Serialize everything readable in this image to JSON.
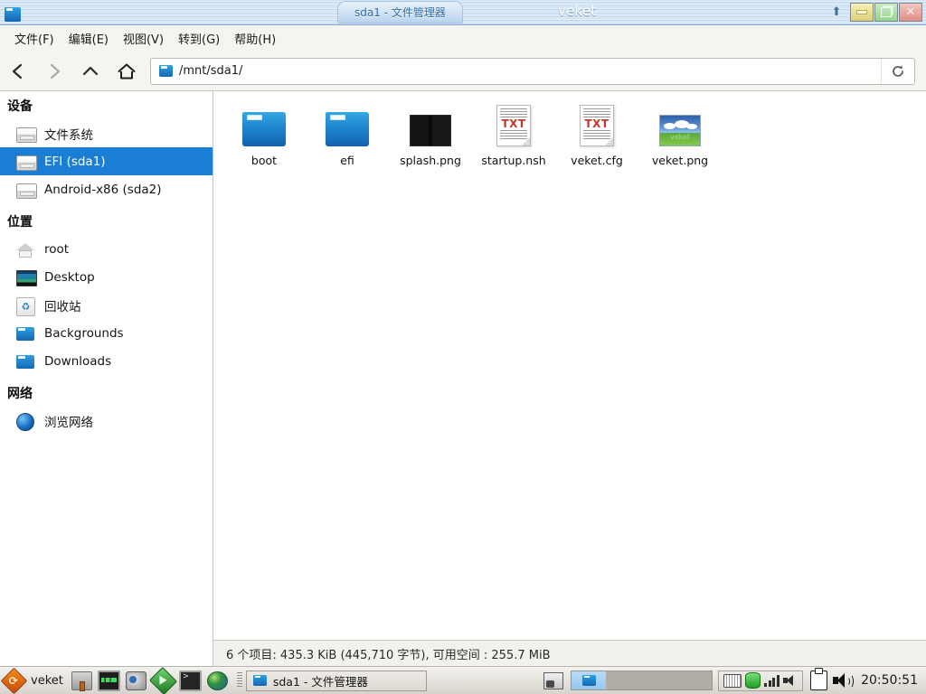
{
  "window": {
    "app_icon": "folder-icon",
    "tab_title": "sda1 - 文件管理器",
    "wm_name": "veket",
    "shade_icon": "arrow-up-icon",
    "minimize_label": "",
    "maximize_label": "",
    "close_label": "✕"
  },
  "menubar": {
    "items": [
      {
        "label": "文件(F)"
      },
      {
        "label": "编辑(E)"
      },
      {
        "label": "视图(V)"
      },
      {
        "label": "转到(G)"
      },
      {
        "label": "帮助(H)"
      }
    ]
  },
  "toolbar": {
    "back_icon": "chevron-left-icon",
    "forward_icon": "chevron-right-icon",
    "up_icon": "chevron-up-icon",
    "home_icon": "home-icon",
    "refresh_icon": "refresh-icon",
    "path_icon": "folder-icon",
    "path_value": "/mnt/sda1/",
    "path_placeholder": "/mnt/sda1/"
  },
  "sidebar": {
    "sections": [
      {
        "title": "设备",
        "items": [
          {
            "label": "文件系统",
            "icon": "drive-icon",
            "selected": false
          },
          {
            "label": "EFI (sda1)",
            "icon": "drive-icon",
            "selected": true
          },
          {
            "label": "Android-x86 (sda2)",
            "icon": "drive-icon",
            "selected": false
          }
        ]
      },
      {
        "title": "位置",
        "items": [
          {
            "label": "root",
            "icon": "home-icon",
            "selected": false
          },
          {
            "label": "Desktop",
            "icon": "monitor-icon",
            "selected": false
          },
          {
            "label": "回收站",
            "icon": "trash-icon",
            "selected": false
          },
          {
            "label": "Backgrounds",
            "icon": "folder-icon",
            "selected": false
          },
          {
            "label": "Downloads",
            "icon": "folder-icon",
            "selected": false
          }
        ]
      },
      {
        "title": "网络",
        "items": [
          {
            "label": "浏览网络",
            "icon": "globe-icon",
            "selected": false
          }
        ]
      }
    ]
  },
  "files": [
    {
      "name": "boot",
      "kind": "folder"
    },
    {
      "name": "efi",
      "kind": "folder"
    },
    {
      "name": "splash.png",
      "kind": "image-dark"
    },
    {
      "name": "startup.nsh",
      "kind": "text-doc",
      "doc_label": "TXT"
    },
    {
      "name": "veket.cfg",
      "kind": "text-doc",
      "doc_label": "TXT"
    },
    {
      "name": "veket.png",
      "kind": "image-veket",
      "watermark": "veket"
    }
  ],
  "statusbar": {
    "text": "6 个项目: 435.3 KiB (445,710 字节), 可用空间 : 255.7 MiB"
  },
  "taskbar": {
    "menu_label": "veket",
    "menu_icon": "veket-menu-icon",
    "launchers": [
      {
        "icon": "paint-icon"
      },
      {
        "icon": "system-monitor-icon"
      },
      {
        "icon": "media-player-icon"
      },
      {
        "icon": "play-icon"
      },
      {
        "icon": "terminal-icon"
      },
      {
        "icon": "browser-globe-icon"
      }
    ],
    "window_buttons": [
      {
        "label": "sda1 - 文件管理器",
        "icon": "folder-icon",
        "active": true
      }
    ],
    "tray": {
      "screenshot_icon": "screenshot-icon",
      "pager_count": 4,
      "pager_active": 1,
      "keyboard_icon": "keyboard-icon",
      "disk_icon": "disk-icon",
      "signal_icon": "signal-icon",
      "volume_small_icon": "volume-small-icon",
      "clipboard_icon": "clipboard-icon",
      "speaker_icon": "speaker-icon",
      "clock": "20:50:51"
    }
  },
  "colors": {
    "selection_blue": "#1a7fd4",
    "titlebar_blue": "#cfe2f6",
    "folder_blue": "#1f86cf",
    "txt_red": "#c0392b",
    "accent_orange": "#f08a18"
  }
}
